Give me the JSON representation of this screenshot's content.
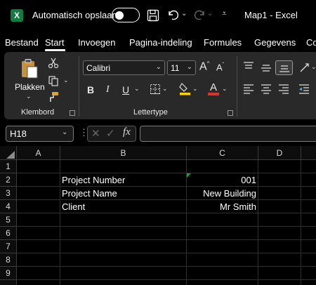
{
  "titlebar": {
    "app_icon": "excel-logo-icon",
    "app_icon_letter": "X",
    "autosave_label": "Automatisch opslaan",
    "autosave_on": false,
    "doc_title": "Map1  -  Excel"
  },
  "tabs": [
    "Bestand",
    "Start",
    "Invoegen",
    "Pagina-indeling",
    "Formules",
    "Gegevens",
    "Co"
  ],
  "active_tab": "Start",
  "ribbon": {
    "clipboard": {
      "paste_label": "Plakken",
      "group_label": "Klembord"
    },
    "font": {
      "font_name": "Calibri",
      "font_size": "11",
      "grow_icon": "A",
      "shrink_icon": "A",
      "bold": "B",
      "italic": "I",
      "underline": "U",
      "font_color_letter": "A",
      "highlight_color": "#ffd400",
      "font_color": "#e0322b",
      "group_label": "Lettertype"
    }
  },
  "formula_bar": {
    "name_box": "H18",
    "fx_label": "fx",
    "formula": ""
  },
  "sheet": {
    "columns": [
      "A",
      "B",
      "C",
      "D"
    ],
    "rows": [
      "1",
      "2",
      "3",
      "4",
      "5",
      "6",
      "7",
      "8",
      "9"
    ],
    "cells": {
      "B2": "Project Number",
      "C2": "001",
      "B3": "Project Name",
      "C3": "New Building",
      "B4": "Client",
      "C4": "Mr Smith"
    },
    "error_indicator_color": "#1e9e3e"
  }
}
